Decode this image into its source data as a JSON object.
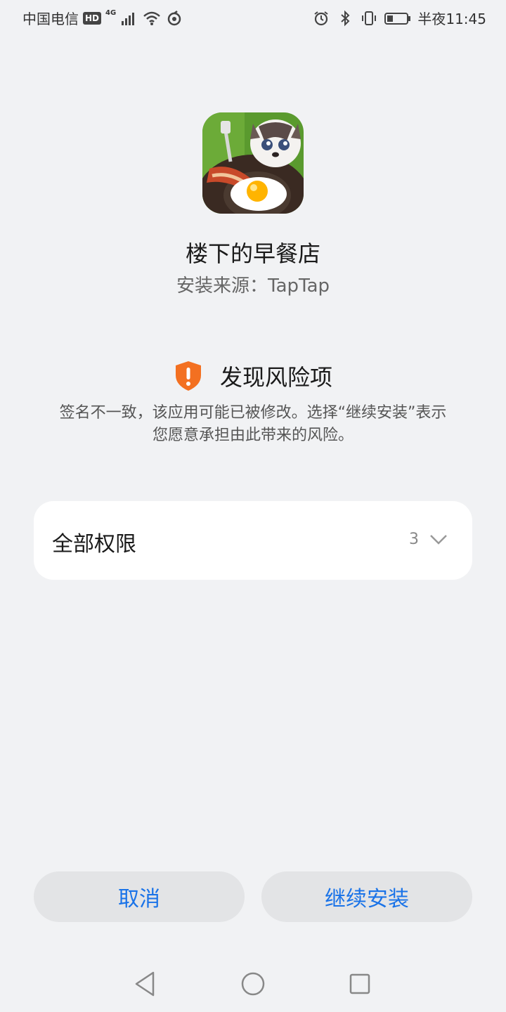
{
  "status_bar": {
    "carrier": "中国电信",
    "hd_badge": "HD",
    "network_type": "4G",
    "time": "半夜11:45"
  },
  "app": {
    "name": "楼下的早餐店",
    "source": "安装来源：TapTap"
  },
  "risk": {
    "title": "发现风险项",
    "description_line1": "签名不一致，该应用可能已被修改。选择“继续安装”表示",
    "description_line2": "您愿意承担由此带来的风险。",
    "accent_color": "#f37021"
  },
  "permissions": {
    "label": "全部权限",
    "count": "3"
  },
  "buttons": {
    "cancel": "取消",
    "continue": "继续安装",
    "label_color": "#1a73e8"
  },
  "icons": {
    "status_left": [
      "signal-icon",
      "wifi-icon",
      "sync-icon"
    ],
    "status_right": [
      "alarm-icon",
      "bluetooth-icon",
      "vibrate-icon",
      "battery-icon"
    ],
    "nav": [
      "back-icon",
      "home-icon",
      "recent-apps-icon"
    ]
  }
}
